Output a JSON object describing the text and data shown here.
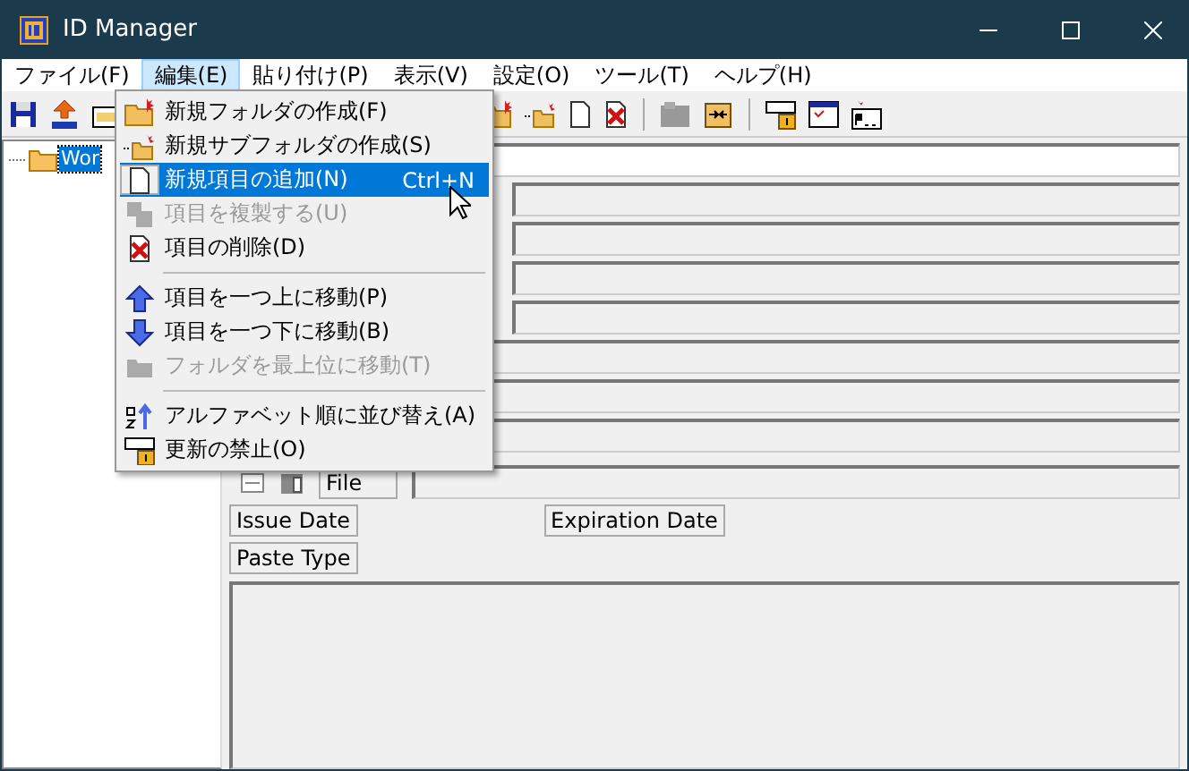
{
  "window": {
    "title": "ID Manager"
  },
  "menu_bar": [
    {
      "label": "ファイル(F)",
      "selected": false
    },
    {
      "label": "編集(E)",
      "selected": true
    },
    {
      "label": "貼り付け(P)",
      "selected": false
    },
    {
      "label": "表示(V)",
      "selected": false
    },
    {
      "label": "設定(O)",
      "selected": false
    },
    {
      "label": "ツール(T)",
      "selected": false
    },
    {
      "label": "ヘルプ(H)",
      "selected": false
    }
  ],
  "edit_menu": [
    {
      "kind": "item",
      "label": "新規フォルダの作成(F)",
      "disabled": false,
      "selected": false
    },
    {
      "kind": "item",
      "label": "新規サブフォルダの作成(S)",
      "disabled": false,
      "selected": false
    },
    {
      "kind": "item",
      "label": "新規項目の追加(N)",
      "shortcut": "Ctrl+N",
      "disabled": false,
      "selected": true
    },
    {
      "kind": "item",
      "label": "項目を複製する(U)",
      "disabled": true,
      "selected": false
    },
    {
      "kind": "item",
      "label": "項目の削除(D)",
      "disabled": false,
      "selected": false
    },
    {
      "kind": "separator"
    },
    {
      "kind": "item",
      "label": "項目を一つ上に移動(P)",
      "disabled": false,
      "selected": false
    },
    {
      "kind": "item",
      "label": "項目を一つ下に移動(B)",
      "disabled": false,
      "selected": false
    },
    {
      "kind": "item",
      "label": "フォルダを最上位に移動(T)",
      "disabled": true,
      "selected": false
    },
    {
      "kind": "separator"
    },
    {
      "kind": "item",
      "label": "アルファベット順に並び替え(A)",
      "disabled": false,
      "selected": false
    },
    {
      "kind": "item",
      "label": "更新の禁止(O)",
      "disabled": false,
      "selected": false
    }
  ],
  "tree": [
    {
      "label": "Wor",
      "selected": true
    }
  ],
  "detail": {
    "file_label": "File",
    "issue_date_label": "Issue Date",
    "expiration_date_label": "Expiration Date",
    "paste_type_label": "Paste Type"
  }
}
